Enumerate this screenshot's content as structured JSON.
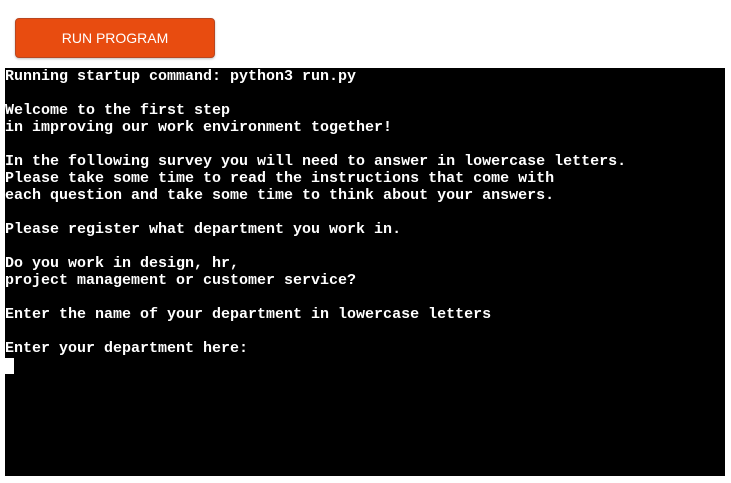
{
  "toolbar": {
    "run_label": "RUN PROGRAM",
    "accent_color": "#e84c10"
  },
  "terminal": {
    "background": "#000000",
    "foreground": "#ffffff",
    "lines": [
      "Running startup command: python3 run.py",
      "",
      "Welcome to the first step",
      "in improving our work environment together!",
      "",
      "In the following survey you will need to answer in lowercase letters.",
      "Please take some time to read the instructions that come with",
      "each question and take some time to think about your answers.",
      "",
      "Please register what department you work in.",
      "",
      "Do you work in design, hr,",
      "project management or customer service?",
      "",
      "Enter the name of your department in lowercase letters",
      "",
      "Enter your department here:"
    ],
    "input_value": ""
  }
}
